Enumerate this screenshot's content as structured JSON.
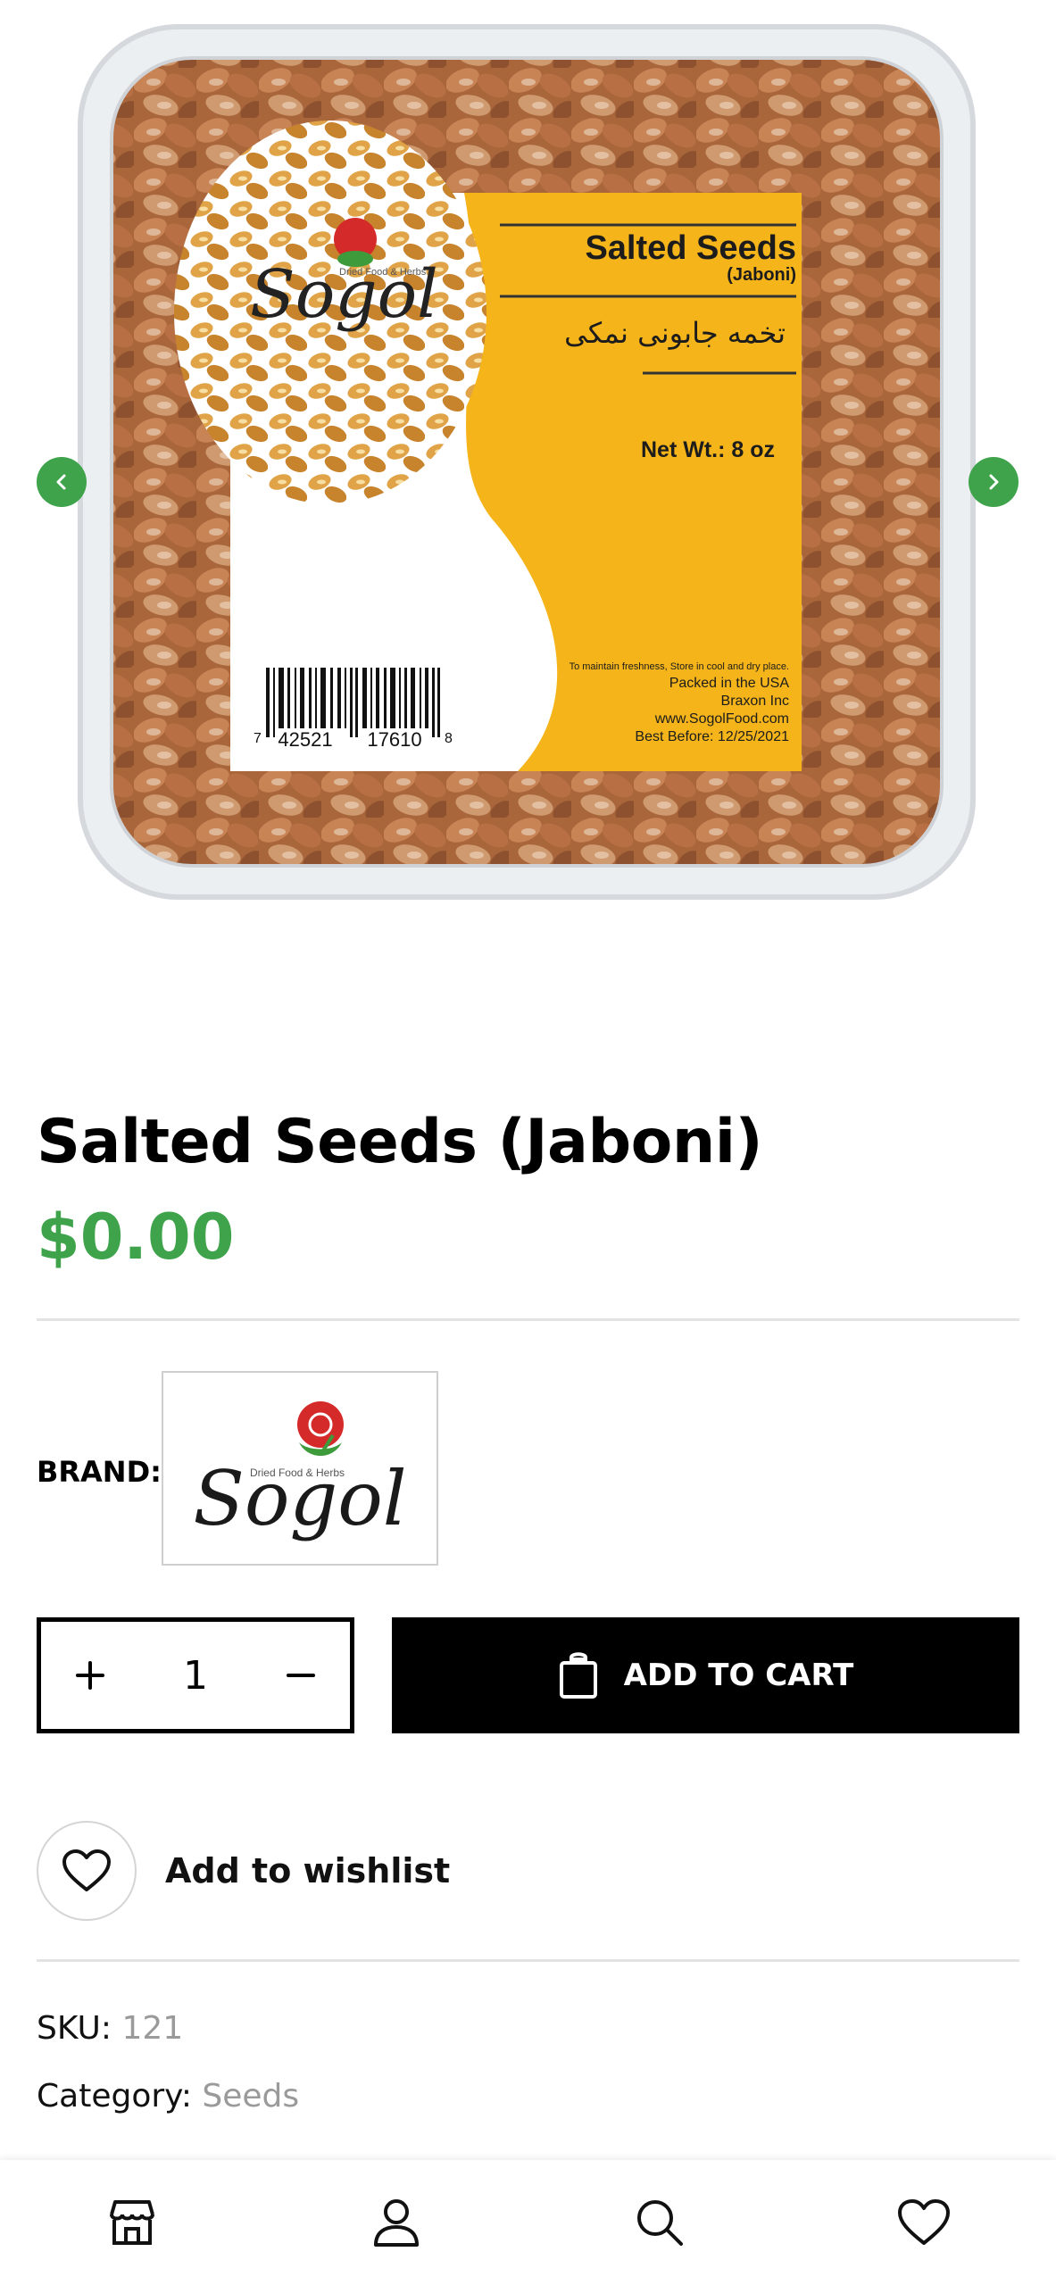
{
  "product": {
    "title": "Salted Seeds (Jaboni)",
    "price": "$0.00",
    "brand_label": "BRAND:",
    "brand_name": "Sogol",
    "brand_tagline": "Dried Food & Herbs",
    "quantity": "1",
    "add_to_cart_label": "ADD TO CART",
    "wishlist_label": "Add to wishlist",
    "sku_label": "SKU:",
    "sku_value": "121",
    "category_label": "Category:",
    "category_value": "Seeds"
  },
  "package_label": {
    "title": "Salted Seeds",
    "subtitle": "(Jaboni)",
    "persian": "تخمه جابونی نمکی",
    "net_wt": "Net Wt.: 8 oz",
    "storage": "To maintain freshness, Store in cool and dry place.",
    "packed": "Packed in the USA",
    "company": "Braxon Inc",
    "website": "www.SogolFood.com",
    "best_before": "Best Before: 12/25/2021",
    "barcode_left": "7",
    "barcode_mid1": "42521",
    "barcode_mid2": "17610",
    "barcode_right": "8"
  },
  "icons": {
    "gallery_prev": "chevron-left-icon",
    "gallery_next": "chevron-right-icon",
    "qty_plus": "plus-icon",
    "qty_minus": "minus-icon",
    "cart": "shopping-bag-icon",
    "wishlist": "heart-icon",
    "nav": [
      "shop-icon",
      "user-icon",
      "search-icon",
      "heart-icon"
    ]
  },
  "colors": {
    "accent_green": "#3ea34a",
    "label_yellow": "#f4b41a",
    "button_black": "#000000",
    "meta_gray": "#9a9a9a"
  }
}
